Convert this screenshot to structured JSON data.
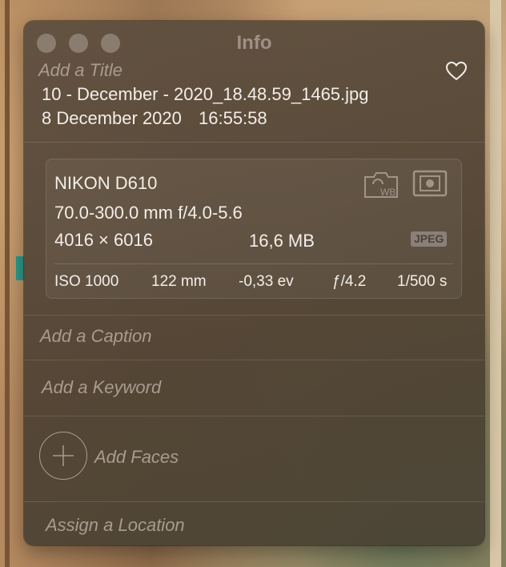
{
  "window": {
    "title": "Info"
  },
  "header": {
    "title_placeholder": "Add a Title",
    "filename": "10 - December - 2020_18.48.59_1465.jpg",
    "date": "8 December 2020",
    "time": "16:55:58",
    "favorite_icon": "heart-outline-icon"
  },
  "camera": {
    "model": "NIKON D610",
    "lens": "70.0-300.0 mm f/4.0-5.6",
    "dimensions": "4016 × 6016",
    "file_size": "16,6 MB",
    "format_badge": "JPEG",
    "icons": [
      "camera-wb-icon",
      "metering-mode-icon"
    ],
    "stats": {
      "iso": "ISO 1000",
      "focal_length": "122 mm",
      "exposure_bias": "-0,33 ev",
      "aperture": "ƒ/4.2",
      "shutter": "1/500 s"
    }
  },
  "fields": {
    "caption_placeholder": "Add a Caption",
    "keyword_placeholder": "Add a Keyword",
    "faces_label": "Add Faces",
    "location_placeholder": "Assign a Location"
  },
  "colors": {
    "panel_bg": "#5a4a3a",
    "text_primary": "#f3eee8",
    "placeholder": "#a89c90",
    "traffic_light": "#8a7c6e"
  }
}
